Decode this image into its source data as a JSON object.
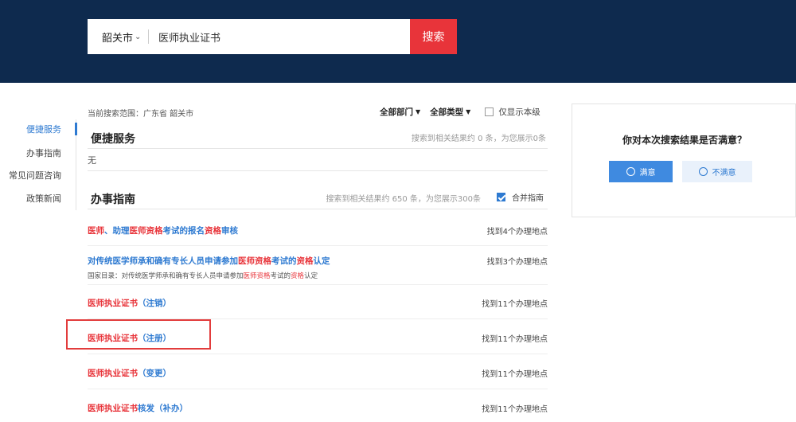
{
  "header": {
    "city": "韶关市",
    "query": "医师执业证书",
    "search_button": "搜索"
  },
  "sidenav": {
    "items": [
      {
        "label": "便捷服务",
        "active": true
      },
      {
        "label": "办事指南",
        "active": false
      },
      {
        "label": "常见问题咨询",
        "active": false
      },
      {
        "label": "政策新闻",
        "active": false
      }
    ]
  },
  "scope": "当前搜索范围：广东省 韶关市",
  "filters": {
    "department": "全部部门",
    "type": "全部类型",
    "only_level": "仅显示本级"
  },
  "services": {
    "title": "便捷服务",
    "meta": "搜索到相关结果约 0 条，为您展示0条",
    "empty": "无"
  },
  "guides": {
    "title": "办事指南",
    "meta": "搜索到相关结果约 650 条，为您展示300条",
    "merge_label": "合并指南",
    "results": [
      {
        "segments": [
          {
            "text": "医师",
            "hl": true
          },
          {
            "text": "、助理",
            "hl": false
          },
          {
            "text": "医师资格",
            "hl": true
          },
          {
            "text": "考试的报名",
            "hl": false
          },
          {
            "text": "资格",
            "hl": true
          },
          {
            "text": "审核",
            "hl": false
          }
        ],
        "count": "找到4个办理地点"
      },
      {
        "segments": [
          {
            "text": "对传统医学师承和确有专长人员申请参加",
            "hl": false
          },
          {
            "text": "医师资格",
            "hl": true
          },
          {
            "text": "考试的",
            "hl": false
          },
          {
            "text": "资格",
            "hl": true
          },
          {
            "text": "认定",
            "hl": false
          }
        ],
        "sub_segments": [
          {
            "text": "国家目录：对传统医学师承和确有专长人员申请参加",
            "hl": false
          },
          {
            "text": "医师资格",
            "hl": true
          },
          {
            "text": "考试的",
            "hl": false
          },
          {
            "text": "资格",
            "hl": true
          },
          {
            "text": "认定",
            "hl": false
          }
        ],
        "count": "找到3个办理地点"
      },
      {
        "segments": [
          {
            "text": "医师执业证书",
            "hl": true
          },
          {
            "text": "（注销）",
            "hl": false
          }
        ],
        "count": "找到11个办理地点"
      },
      {
        "segments": [
          {
            "text": "医师执业证书",
            "hl": true
          },
          {
            "text": "（注册）",
            "hl": false
          }
        ],
        "count": "找到11个办理地点"
      },
      {
        "segments": [
          {
            "text": "医师执业证书",
            "hl": true
          },
          {
            "text": "（变更）",
            "hl": false
          }
        ],
        "count": "找到11个办理地点"
      },
      {
        "segments": [
          {
            "text": "医师执业证书",
            "hl": true
          },
          {
            "text": "核发（补办）",
            "hl": false
          }
        ],
        "count": "找到11个办理地点"
      }
    ]
  },
  "feedback": {
    "question": "你对本次搜索结果是否满意？",
    "satisfied": "满意",
    "unsatisfied": "不满意"
  },
  "colors": {
    "header_bg": "#0e2a4e",
    "accent": "#2e7ad1",
    "highlight": "#e8343a",
    "search_button": "#e8343a"
  }
}
